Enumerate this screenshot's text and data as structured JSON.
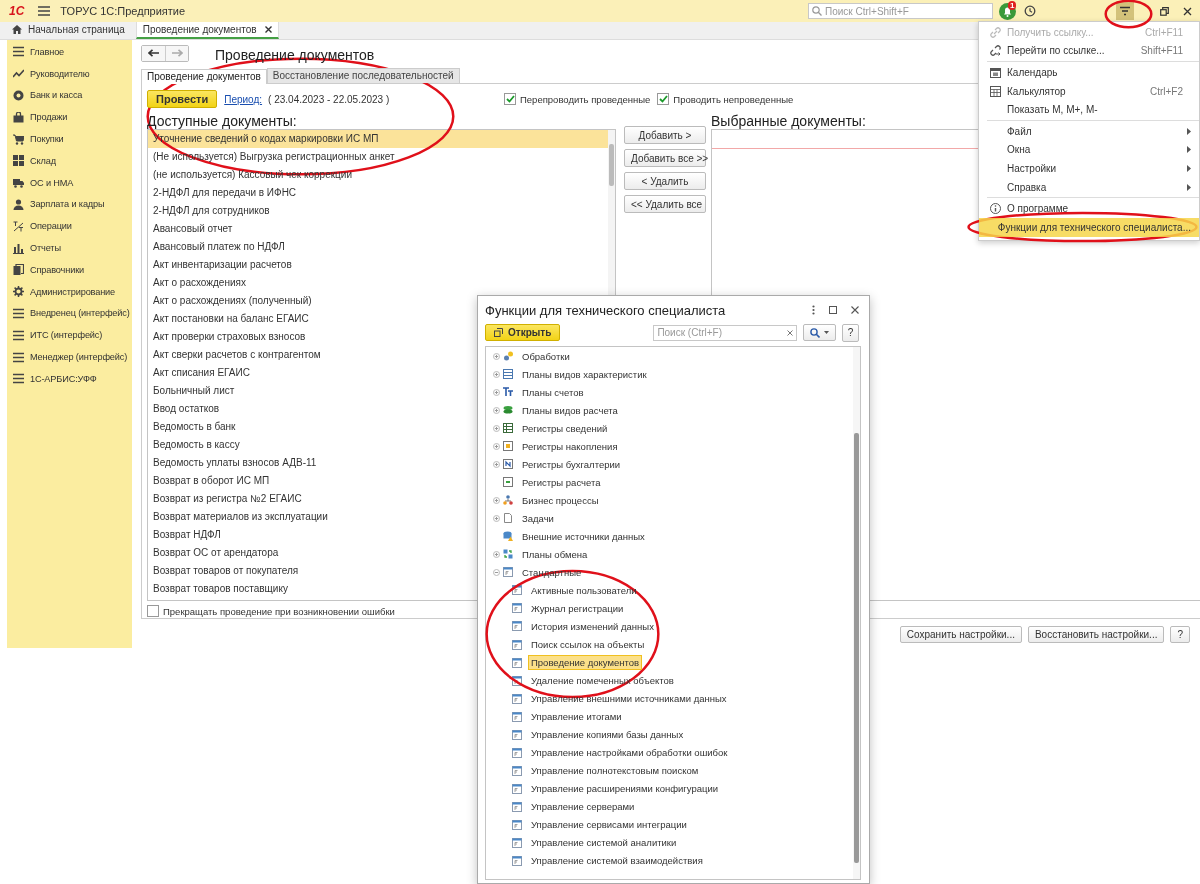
{
  "title_bar": {
    "logo": "1С",
    "title": "ТОРУС 1С:Предприятие",
    "search": {
      "placeholder": "Поиск Ctrl+Shift+F"
    },
    "notification_count": "1"
  },
  "open_tabs": [
    {
      "label": "Начальная страница",
      "selected": false
    },
    {
      "label": "Проведение документов",
      "selected": true
    }
  ],
  "sidebar": {
    "items": [
      {
        "label": "Главное"
      },
      {
        "label": "Руководителю"
      },
      {
        "label": "Банк и касса"
      },
      {
        "label": "Продажи"
      },
      {
        "label": "Покупки"
      },
      {
        "label": "Склад"
      },
      {
        "label": "ОС и НМА"
      },
      {
        "label": "Зарплата и кадры"
      },
      {
        "label": "Операции"
      },
      {
        "label": "Отчеты"
      },
      {
        "label": "Справочники"
      },
      {
        "label": "Администрирование"
      },
      {
        "label": "Внедренец (интерфейс)"
      },
      {
        "label": "ИТС (интерфейс)"
      },
      {
        "label": "Менеджер (интерфейс)"
      },
      {
        "label": "1С-АРБИС:УФФ"
      }
    ]
  },
  "form": {
    "title": "Проведение документов",
    "tabs": [
      {
        "label": "Проведение документов",
        "selected": true
      },
      {
        "label": "Восстановление последовательностей",
        "selected": false
      }
    ],
    "post_button": "Провести",
    "period_link": "Период:",
    "period_value": "( 23.04.2023 - 22.05.2023 )",
    "options": [
      {
        "label": "Перепроводить проведенные",
        "checked": true
      },
      {
        "label": "Проводить непроведенные",
        "checked": true
      }
    ],
    "available": {
      "heading": "Доступные документы:",
      "rows": [
        {
          "text": "Уточнение сведений о кодах маркировки ИС МП",
          "selected": true
        },
        {
          "text": "(Не используется) Выгрузка регистрационных анкет",
          "selected": false
        },
        {
          "text": "(не используется) Кассовый чек коррекции",
          "selected": false
        },
        {
          "text": "2-НДФЛ для передачи в ИФНС",
          "selected": false
        },
        {
          "text": "2-НДФЛ для сотрудников",
          "selected": false
        },
        {
          "text": "Авансовый отчет",
          "selected": false
        },
        {
          "text": "Авансовый платеж по НДФЛ",
          "selected": false
        },
        {
          "text": "Акт инвентаризации расчетов",
          "selected": false
        },
        {
          "text": "Акт о расхождениях",
          "selected": false
        },
        {
          "text": "Акт о расхождениях (полученный)",
          "selected": false
        },
        {
          "text": "Акт постановки на баланс ЕГАИС",
          "selected": false
        },
        {
          "text": "Акт проверки страховых взносов",
          "selected": false
        },
        {
          "text": "Акт сверки расчетов с контрагентом",
          "selected": false
        },
        {
          "text": "Акт списания ЕГАИС",
          "selected": false
        },
        {
          "text": "Больничный лист",
          "selected": false
        },
        {
          "text": "Ввод остатков",
          "selected": false
        },
        {
          "text": "Ведомость в банк",
          "selected": false
        },
        {
          "text": "Ведомость в кассу",
          "selected": false
        },
        {
          "text": "Ведомость уплаты взносов АДВ-11",
          "selected": false
        },
        {
          "text": "Возврат в оборот ИС МП",
          "selected": false
        },
        {
          "text": "Возврат из регистра №2 ЕГАИС",
          "selected": false
        },
        {
          "text": "Возврат материалов из эксплуатации",
          "selected": false
        },
        {
          "text": "Возврат НДФЛ",
          "selected": false
        },
        {
          "text": "Возврат ОС от арендатора",
          "selected": false
        },
        {
          "text": "Возврат товаров от покупателя",
          "selected": false
        },
        {
          "text": "Возврат товаров поставщику",
          "selected": false
        }
      ]
    },
    "transfer_buttons": [
      "Добавить >",
      "Добавить все >>",
      "< Удалить",
      "<< Удалить все"
    ],
    "chosen": {
      "heading": "Выбранные документы:"
    },
    "stop_on_error": {
      "label": "Прекращать проведение при возникновении ошибки",
      "checked": false
    }
  },
  "footer_buttons": [
    "Сохранить настройки...",
    "Восстановить настройки...",
    "?"
  ],
  "main_menu": {
    "items": [
      {
        "kind": "item",
        "label": "Получить ссылку...",
        "shortcut": "Ctrl+F11",
        "submenu": false,
        "disabled": true,
        "selected": false
      },
      {
        "kind": "item",
        "label": "Перейти по ссылке...",
        "shortcut": "Shift+F11",
        "submenu": false,
        "disabled": false,
        "selected": false
      },
      {
        "kind": "separator"
      },
      {
        "kind": "item",
        "label": "Календарь",
        "submenu": false,
        "disabled": false,
        "selected": false
      },
      {
        "kind": "item",
        "label": "Калькулятор",
        "shortcut": "Ctrl+F2",
        "submenu": false,
        "disabled": false,
        "selected": false
      },
      {
        "kind": "item",
        "label": "Показать M, M+, M-",
        "submenu": false,
        "disabled": false,
        "selected": false
      },
      {
        "kind": "separator"
      },
      {
        "kind": "item",
        "label": "Файл",
        "submenu": true,
        "disabled": false,
        "selected": false
      },
      {
        "kind": "item",
        "label": "Окна",
        "submenu": true,
        "disabled": false,
        "selected": false
      },
      {
        "kind": "item",
        "label": "Настройки",
        "submenu": true,
        "disabled": false,
        "selected": false
      },
      {
        "kind": "item",
        "label": "Справка",
        "submenu": true,
        "disabled": false,
        "selected": false
      },
      {
        "kind": "separator"
      },
      {
        "kind": "item",
        "label": "О программе",
        "submenu": false,
        "disabled": false,
        "selected": false
      },
      {
        "kind": "item",
        "label": "Функции для технического специалиста...",
        "submenu": false,
        "disabled": false,
        "selected": true
      }
    ]
  },
  "dialog": {
    "title": "Функции для технического специалиста",
    "open_button": "Открыть",
    "search": {
      "placeholder": "Поиск (Ctrl+F)"
    },
    "help_button": "?",
    "tree": [
      {
        "label": "Обработки",
        "kind": "group",
        "expanded": false,
        "selected": false
      },
      {
        "label": "Планы видов характеристик",
        "kind": "group",
        "expanded": false,
        "selected": false
      },
      {
        "label": "Планы счетов",
        "kind": "group",
        "expanded": false,
        "selected": false
      },
      {
        "label": "Планы видов расчета",
        "kind": "group",
        "expanded": false,
        "selected": false
      },
      {
        "label": "Регистры сведений",
        "kind": "group",
        "expanded": false,
        "selected": false
      },
      {
        "label": "Регистры накопления",
        "kind": "group",
        "expanded": false,
        "selected": false
      },
      {
        "label": "Регистры бухгалтерии",
        "kind": "group",
        "expanded": false,
        "selected": false
      },
      {
        "label": "Регистры расчета",
        "kind": "plain",
        "selected": false
      },
      {
        "label": "Бизнес процессы",
        "kind": "group",
        "expanded": false,
        "selected": false
      },
      {
        "label": "Задачи",
        "kind": "group",
        "expanded": false,
        "selected": false
      },
      {
        "label": "Внешние источники данных",
        "kind": "plain",
        "selected": false
      },
      {
        "label": "Планы обмена",
        "kind": "group",
        "expanded": false,
        "selected": false
      },
      {
        "label": "Стандартные",
        "kind": "group",
        "expanded": true,
        "selected": false,
        "children": [
          {
            "label": "Активные пользователи",
            "selected": false
          },
          {
            "label": "Журнал регистрации",
            "selected": false
          },
          {
            "label": "История изменений данных",
            "selected": false
          },
          {
            "label": "Поиск ссылок на объекты",
            "selected": false
          },
          {
            "label": "Проведение документов",
            "selected": true
          },
          {
            "label": "Удаление помеченных объектов",
            "selected": false
          },
          {
            "label": "Управление внешними источниками данных",
            "selected": false
          },
          {
            "label": "Управление итогами",
            "selected": false
          },
          {
            "label": "Управление копиями базы данных",
            "selected": false
          },
          {
            "label": "Управление настройками обработки ошибок",
            "selected": false
          },
          {
            "label": "Управление полнотекстовым поиском",
            "selected": false
          },
          {
            "label": "Управление расширениями конфигурации",
            "selected": false
          },
          {
            "label": "Управление серверами",
            "selected": false
          },
          {
            "label": "Управление сервисами интеграции",
            "selected": false
          },
          {
            "label": "Управление системой аналитики",
            "selected": false
          },
          {
            "label": "Управление системой взаимодействия",
            "selected": false
          }
        ]
      }
    ]
  },
  "annotations": [
    {
      "kind": "ellipse"
    },
    {
      "kind": "ellipse"
    },
    {
      "kind": "ellipse"
    },
    {
      "kind": "ellipse"
    }
  ]
}
